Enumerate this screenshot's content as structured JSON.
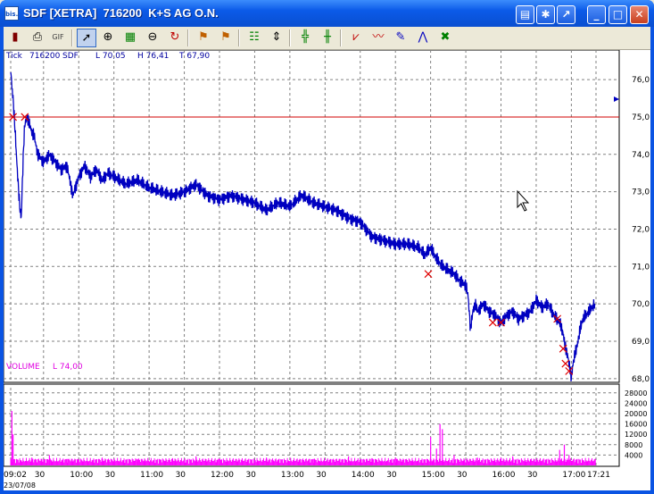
{
  "window": {
    "title": "SDF [XETRA]  716200  K+S AG O.N.",
    "app_icon": "bis.",
    "caption_buttons": [
      "minimize-icon",
      "maximize-icon",
      "close-icon"
    ],
    "extra_buttons": [
      "toolbox-icon",
      "settings-icon",
      "export-icon"
    ]
  },
  "toolbar": {
    "icons": [
      "book-icon",
      "print-icon",
      "gif-icon",
      "pointer-icon",
      "zoom-in-icon",
      "chart-area-icon",
      "zoom-out-icon",
      "refresh-icon",
      "indicator-icon",
      "indicator2-icon",
      "table-icon",
      "compress-icon",
      "grid-icon",
      "grid2-icon",
      "line-tool-icon",
      "wave-icon",
      "pencil-icon",
      "fan-icon",
      "cross-lines-icon"
    ],
    "active": "pointer-icon"
  },
  "header": {
    "mode": "Tick",
    "wkn": "716200",
    "symbol": "SDF",
    "low": "L  70,05",
    "high": "H  76,41",
    "last": "T  67,90"
  },
  "volume_header": {
    "title": "VOLUME",
    "value": "L  74,00"
  },
  "date_label": "23/07/08",
  "colors": {
    "price": "#0000c0",
    "volume": "#ff00ff",
    "hline": "#d00000",
    "grid": "#808080",
    "markers": "#e00000"
  },
  "chart_data": [
    {
      "type": "line",
      "title": "SDF [XETRA]  716200  K+S AG O.N.",
      "x_ticks": [
        "09:02",
        "30",
        "10:00",
        "30",
        "11:00",
        "30",
        "12:00",
        "30",
        "13:00",
        "30",
        "14:00",
        "30",
        "15:00",
        "30",
        "16:00",
        "30",
        "17:00",
        "17:21"
      ],
      "x_tick_times": [
        542,
        570,
        600,
        630,
        660,
        690,
        720,
        750,
        780,
        810,
        840,
        870,
        900,
        930,
        960,
        990,
        1020,
        1041
      ],
      "y_ticks": [
        "76,0",
        "75,0",
        "74,0",
        "73,0",
        "72,0",
        "71,0",
        "70,0",
        "69,0",
        "68,0"
      ],
      "ylim": [
        67.9,
        76.6
      ],
      "reference_line": 75.0,
      "series": [
        {
          "values_time": [
            542,
            543,
            544,
            545,
            546,
            547,
            548,
            549,
            550,
            551,
            552,
            553,
            554,
            556,
            558,
            560,
            562,
            565,
            570,
            575,
            580,
            585,
            590,
            595,
            600,
            605,
            610,
            615,
            620,
            625,
            630,
            640,
            650,
            660,
            670,
            680,
            690,
            700,
            710,
            720,
            730,
            740,
            750,
            760,
            770,
            780,
            790,
            800,
            810,
            820,
            830,
            840,
            850,
            860,
            870,
            880,
            890,
            895,
            900,
            905,
            910,
            915,
            920,
            925,
            930,
            932,
            934,
            936,
            938,
            940,
            945,
            950,
            955,
            960,
            965,
            970,
            975,
            980,
            985,
            990,
            995,
            1000,
            1005,
            1010,
            1013,
            1015,
            1017,
            1019,
            1020,
            1021,
            1022,
            1025,
            1028,
            1030,
            1035,
            1040
          ],
          "values_price": [
            76.3,
            75.8,
            75.5,
            75.0,
            74.5,
            73.9,
            73.4,
            72.9,
            72.5,
            72.3,
            73.3,
            74.2,
            74.8,
            75.0,
            74.8,
            74.6,
            74.5,
            74.0,
            73.8,
            74.0,
            73.8,
            73.6,
            73.7,
            72.9,
            73.4,
            73.7,
            73.4,
            73.6,
            73.3,
            73.5,
            73.4,
            73.2,
            73.3,
            73.1,
            73.0,
            72.9,
            73.0,
            73.2,
            72.9,
            72.8,
            72.9,
            72.8,
            72.7,
            72.5,
            72.7,
            72.6,
            72.9,
            72.7,
            72.6,
            72.5,
            72.3,
            72.2,
            71.8,
            71.7,
            71.6,
            71.6,
            71.5,
            71.3,
            71.5,
            71.2,
            71.0,
            70.9,
            70.8,
            70.6,
            70.5,
            70.2,
            69.3,
            69.8,
            70.0,
            69.8,
            70.0,
            69.8,
            69.7,
            69.5,
            69.7,
            69.8,
            69.6,
            69.7,
            69.8,
            70.1,
            69.9,
            70.0,
            69.7,
            69.5,
            69.2,
            68.8,
            68.6,
            68.2,
            68.0,
            68.3,
            68.5,
            68.9,
            69.4,
            69.6,
            69.8,
            70.0
          ],
          "markers_time": [
            544,
            554,
            898,
            953,
            960,
            1008,
            1013,
            1015,
            1018
          ],
          "markers_price": [
            75.0,
            75.0,
            70.8,
            69.5,
            69.5,
            69.6,
            68.8,
            68.4,
            68.2
          ]
        }
      ]
    },
    {
      "type": "bar",
      "title": "VOLUME",
      "y_ticks": [
        "28000",
        "24000",
        "20000",
        "16000",
        "12000",
        "8000",
        "4000"
      ],
      "ylim": [
        0,
        30000
      ],
      "series": [
        {
          "name": "VOLUME",
          "spikes_time": [
            543,
            544,
            560,
            575,
            590,
            620,
            650,
            680,
            700,
            720,
            760,
            800,
            830,
            850,
            870,
            900,
            905,
            908,
            910,
            920,
            940,
            960,
            970,
            1010,
            1014,
            1018
          ],
          "spikes_value": [
            21000,
            12000,
            3000,
            4000,
            2500,
            3000,
            2500,
            2800,
            3500,
            2600,
            3000,
            2500,
            3500,
            2800,
            3000,
            11000,
            6500,
            16000,
            14000,
            4000,
            3000,
            3000,
            3500,
            6000,
            8000,
            4000
          ]
        }
      ]
    }
  ]
}
